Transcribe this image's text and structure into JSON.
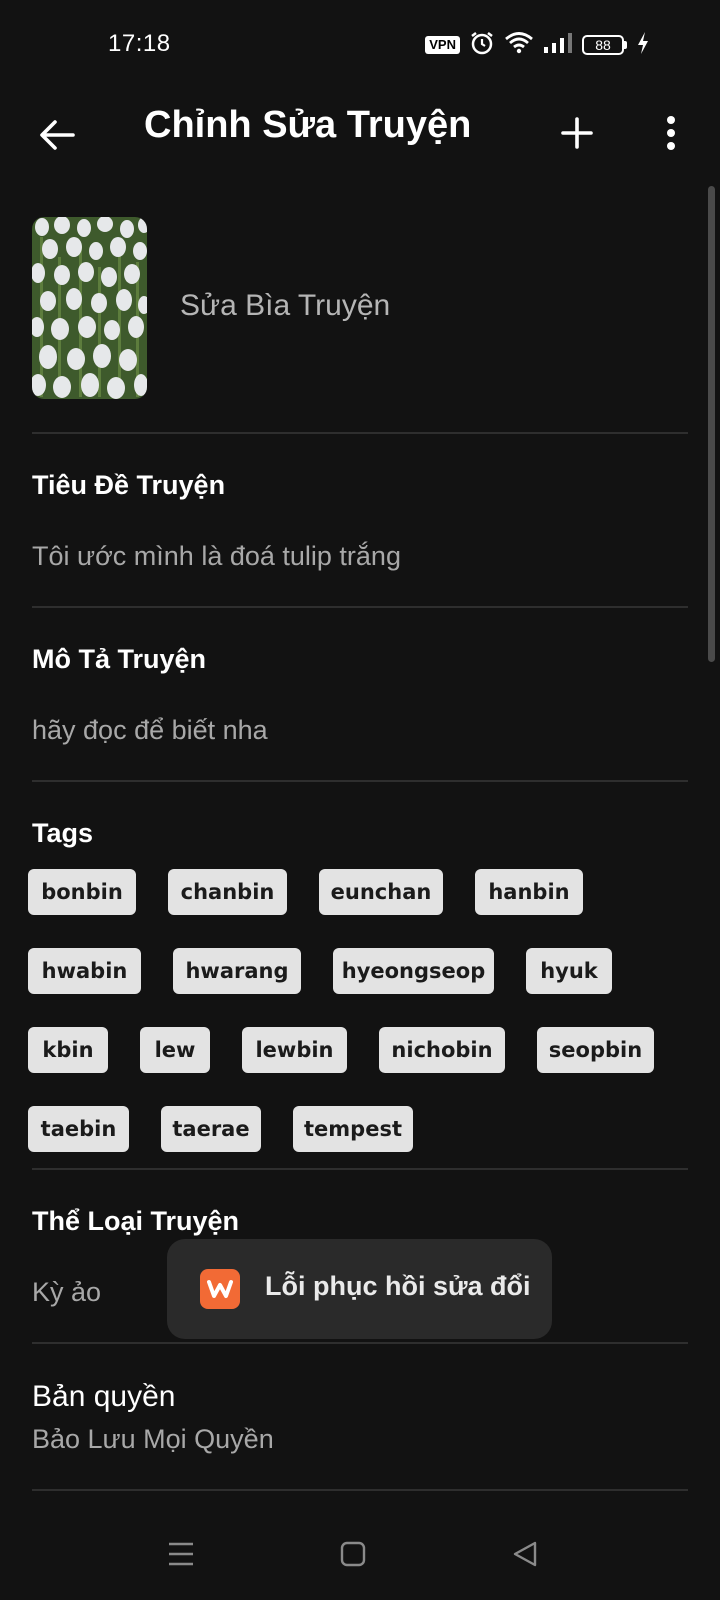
{
  "status_bar": {
    "time": "17:18",
    "vpn": "VPN",
    "battery": "88",
    "icons": [
      "vpn-icon",
      "alarm-icon",
      "wifi-icon",
      "signal-icon",
      "battery-icon",
      "charging-icon"
    ]
  },
  "app_bar": {
    "title": "Chỉnh Sửa Truyện",
    "icons": [
      "back-arrow-icon",
      "plus-icon",
      "more-vertical-icon"
    ]
  },
  "cover": {
    "label": "Sửa Bìa Truyện",
    "image": "white-tulips-cover"
  },
  "story_title": {
    "label": "Tiêu Đề Truyện",
    "value": "Tôi ước mình là đoá tulip trắng"
  },
  "description": {
    "label": "Mô Tả Truyện",
    "value": "hãy đọc để biết nha"
  },
  "tags": {
    "label": "Tags",
    "items": [
      "bonbin",
      "chanbin",
      "eunchan",
      "hanbin",
      "hwabin",
      "hwarang",
      "hyeongseop",
      "hyuk",
      "kbin",
      "lew",
      "lewbin",
      "nichobin",
      "seopbin",
      "taebin",
      "taerae",
      "tempest"
    ]
  },
  "genre": {
    "label": "Thể Loại Truyện",
    "value": "Kỳ ảo"
  },
  "copyright": {
    "label": "Bản quyền",
    "value": "Bảo Lưu Mọi Quyền"
  },
  "toast": {
    "message": "Lỗi phục hồi sửa đổi",
    "icon": "wattpad-logo-icon"
  },
  "colors": {
    "background": "#121212",
    "tag_bg": "#e3e3e3",
    "toast_bg": "#2a2a2a",
    "accent": "#f26a35"
  }
}
